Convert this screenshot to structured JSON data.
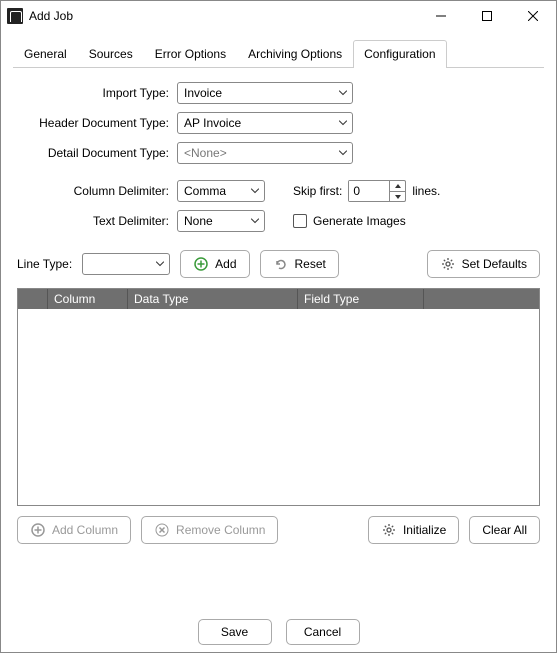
{
  "window": {
    "title": "Add Job"
  },
  "tabs": {
    "general": "General",
    "sources": "Sources",
    "error": "Error Options",
    "archiving": "Archiving Options",
    "config": "Configuration"
  },
  "fields": {
    "importTypeLabel": "Import Type:",
    "importTypeValue": "Invoice",
    "headerDocLabel": "Header Document Type:",
    "headerDocValue": "AP Invoice",
    "detailDocLabel": "Detail Document Type:",
    "detailDocValue": "<None>",
    "colDelimLabel": "Column Delimiter:",
    "colDelimValue": "Comma",
    "textDelimLabel": "Text Delimiter:",
    "textDelimValue": "None",
    "skipFirstLabel": "Skip first:",
    "skipFirstValue": "0",
    "linesLabel": "lines.",
    "genImagesLabel": "Generate Images",
    "lineTypeLabel": "Line Type:",
    "lineTypeValue": ""
  },
  "buttons": {
    "add": "Add",
    "reset": "Reset",
    "setDefaults": "Set Defaults",
    "addColumn": "Add Column",
    "removeColumn": "Remove Column",
    "initialize": "Initialize",
    "clearAll": "Clear All",
    "save": "Save",
    "cancel": "Cancel"
  },
  "grid": {
    "headers": {
      "col": "Column",
      "dtype": "Data Type",
      "ftype": "Field Type"
    }
  }
}
